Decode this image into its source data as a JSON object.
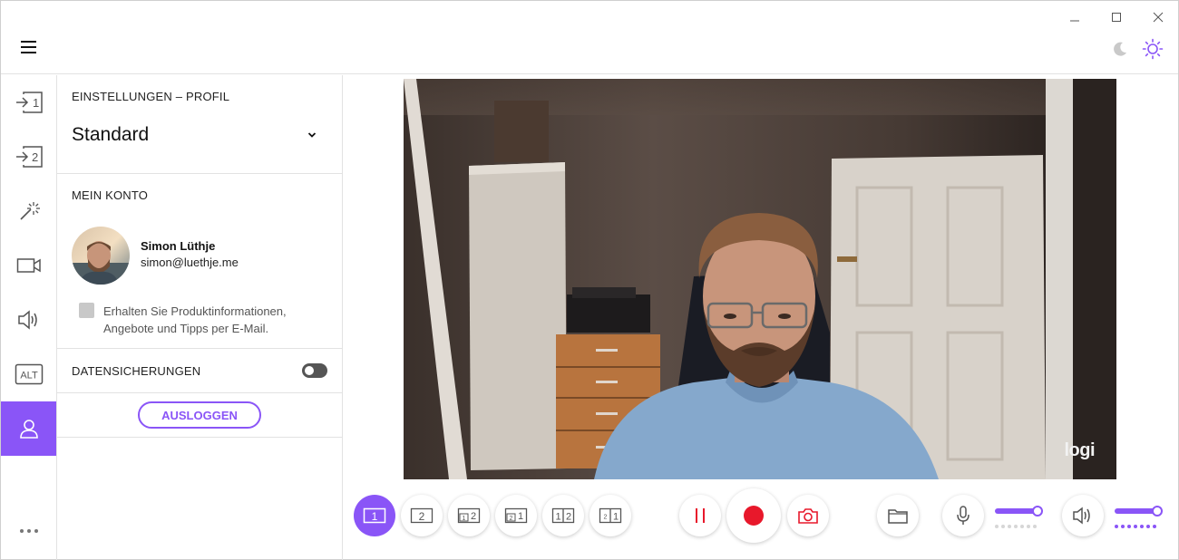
{
  "window": {
    "controls": [
      "minimize",
      "maximize",
      "close"
    ],
    "theme_icons": [
      "moon-icon",
      "sun-icon"
    ]
  },
  "rail": {
    "items": [
      {
        "icon": "camera-1-input-icon",
        "label": "1"
      },
      {
        "icon": "camera-2-input-icon",
        "label": "2"
      },
      {
        "icon": "magic-wand-icon"
      },
      {
        "icon": "video-camera-icon"
      },
      {
        "icon": "speaker-icon"
      },
      {
        "icon": "alt-shortcut-icon",
        "label": "ALT"
      },
      {
        "icon": "user-profile-icon",
        "active": true
      }
    ],
    "more": "..."
  },
  "panel": {
    "section_title": "EINSTELLUNGEN – PROFIL",
    "profile_value": "Standard",
    "account_title": "MEIN KONTO",
    "user_name": "Simon Lüthje",
    "user_email": "simon@luethje.me",
    "newsletter_label": "Erhalten Sie Produktinformationen, Angebote und Tipps per E-Mail.",
    "newsletter_checked": false,
    "backups_label": "DATENSICHERUNGEN",
    "backups_enabled": false,
    "logout_label": "AUSLOGGEN"
  },
  "preview": {
    "watermark": "logi"
  },
  "controls": {
    "layouts": [
      {
        "name": "layout-1",
        "labels": [
          "1"
        ],
        "active": true
      },
      {
        "name": "layout-2",
        "labels": [
          "2"
        ]
      },
      {
        "name": "layout-pip-1-2",
        "labels": [
          "1",
          "2"
        ]
      },
      {
        "name": "layout-pip-2-1",
        "labels": [
          "2",
          "1"
        ]
      },
      {
        "name": "layout-split-1-2",
        "labels": [
          "1",
          "2"
        ]
      },
      {
        "name": "layout-split-2-1",
        "labels": [
          "2",
          "1"
        ]
      }
    ],
    "accent_color": "#8a55f7",
    "record_color": "#e8182b",
    "mic_level": 1.0,
    "speaker_level": 1.0
  }
}
